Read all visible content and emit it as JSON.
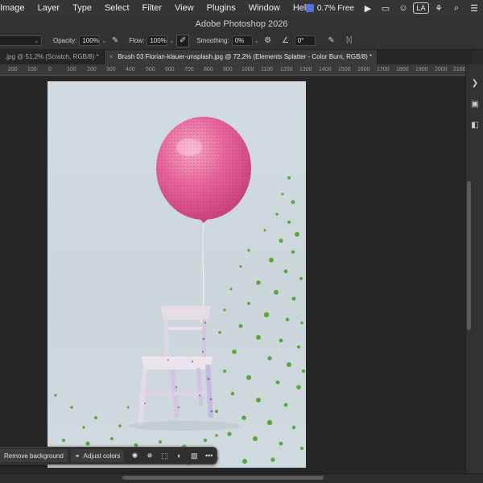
{
  "menubar": {
    "items": [
      "Image",
      "Layer",
      "Type",
      "Select",
      "Filter",
      "View",
      "Plugins",
      "Window",
      "Help"
    ],
    "status_free": "0.7% Free",
    "input_badge": "LA",
    "icons": [
      "app-status-icon",
      "play-icon",
      "window-icon",
      "user-icon",
      "input-source-icon",
      "cast-icon",
      "search-icon",
      "control-center-icon"
    ]
  },
  "title": "Adobe Photoshop 2026",
  "options": {
    "opacity_label": "Opacity:",
    "opacity_value": "100%",
    "flow_label": "Flow:",
    "flow_value": "100%",
    "smoothing_label": "Smoothing:",
    "smoothing_value": "0%",
    "angle_value": "0°"
  },
  "tabs": [
    {
      "label": ".jpg @ 51,2% (Scratch, RGB/8) *",
      "active": false
    },
    {
      "label": "Brush 03 Florian-klauer-unsplash.jpg @ 72,2% (Elements Splatter - Color Burn, RGB/8) *",
      "active": true
    }
  ],
  "ruler": [
    "200",
    "100",
    "0",
    "100",
    "200",
    "300",
    "400",
    "500",
    "600",
    "700",
    "800",
    "900",
    "1000",
    "1100",
    "1200",
    "1300",
    "1400",
    "1500",
    "1600",
    "1700",
    "1800",
    "1900",
    "2000",
    "2100"
  ],
  "taskbar": {
    "remove_bg": "Remove background",
    "adjust_colors": "Adjust colors",
    "more": "•••"
  },
  "colors": {
    "balloon": "#e8669a",
    "splatter": "#5aa83d",
    "chair": "#e5dde6",
    "chair_shade": "#5a4fc0",
    "backdrop": "#cfd8dd"
  }
}
